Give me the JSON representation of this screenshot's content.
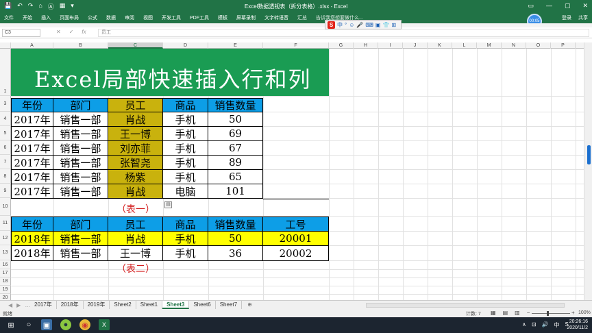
{
  "window": {
    "title": "Excel数据透视表（拆分表格）.xlsx - Excel"
  },
  "quick_access": [
    "💾",
    "↶",
    "↷",
    "⌂",
    "Ⓐ",
    "▦",
    "▾"
  ],
  "window_controls": [
    "▭",
    "—",
    "▢",
    "✕"
  ],
  "menu": [
    "文件",
    "开始",
    "插入",
    "页面布局",
    "公式",
    "数据",
    "审阅",
    "视图",
    "开发工具",
    "PDF工具",
    "模板",
    "屏幕录制",
    "文字转语音",
    "汇总"
  ],
  "tell_me": "告诉我您想要做什么...",
  "account": {
    "login": "登录",
    "share": "共享"
  },
  "recording": "00:05",
  "ime_bar": {
    "logo": "S",
    "items": [
      "中",
      "°",
      "☺",
      "🎤",
      "⌨",
      "▣",
      "👕",
      "⊞"
    ]
  },
  "formula_bar": {
    "name_box": "C3",
    "cancel": "✕",
    "enter": "✓",
    "fx": "fx",
    "formula": "员工"
  },
  "columns": [
    "A",
    "B",
    "C",
    "D",
    "E",
    "F",
    "G",
    "H",
    "I",
    "J",
    "K",
    "L",
    "M",
    "N",
    "O",
    "P"
  ],
  "rows": [
    "1",
    "3",
    "4",
    "5",
    "6",
    "7",
    "8",
    "9",
    "10",
    "11",
    "12",
    "13",
    "16",
    "17",
    "18",
    "19",
    "20"
  ],
  "banner": {
    "text": "Excel局部快速插入行和列"
  },
  "table1": {
    "headers": [
      "年份",
      "部门",
      "员工",
      "商品",
      "销售数量"
    ],
    "rows": [
      [
        "2017年",
        "销售一部",
        "肖战",
        "手机",
        "50"
      ],
      [
        "2017年",
        "销售一部",
        "王一博",
        "手机",
        "69"
      ],
      [
        "2017年",
        "销售一部",
        "刘亦菲",
        "手机",
        "67"
      ],
      [
        "2017年",
        "销售一部",
        "张智尧",
        "手机",
        "89"
      ],
      [
        "2017年",
        "销售一部",
        "杨紫",
        "手机",
        "65"
      ],
      [
        "2017年",
        "销售一部",
        "肖战",
        "电脑",
        "101"
      ]
    ],
    "caption": "（表一）"
  },
  "table2": {
    "headers": [
      "年份",
      "部门",
      "员工",
      "商品",
      "销售数量",
      "工号"
    ],
    "rows": [
      [
        "2018年",
        "销售一部",
        "肖战",
        "手机",
        "50",
        "20001"
      ],
      [
        "2018年",
        "销售一部",
        "王一博",
        "手机",
        "36",
        "20002"
      ]
    ],
    "caption": "（表二）"
  },
  "sheets": [
    "2017年",
    "2018年",
    "2019年",
    "Sheet2",
    "Sheet1",
    "Sheet3",
    "Sheet6",
    "Sheet7"
  ],
  "active_sheet": "Sheet3",
  "add_sheet": "⊕",
  "tab_nav": [
    "◀",
    "▶",
    "…"
  ],
  "status": {
    "ready": "就绪",
    "count": "计数: 7",
    "zoom": "100%",
    "views": [
      "▦",
      "▤",
      "▥"
    ],
    "zoom_minus": "−",
    "zoom_plus": "+"
  },
  "taskbar": {
    "start": "⊞",
    "search": "○",
    "time": "20:26:16",
    "date": "2020/11/2",
    "tray": [
      "∧",
      "⊡",
      "🔊",
      "中",
      "S"
    ]
  },
  "colors": {
    "excel_green": "#217346",
    "banner_green": "#1a9c53",
    "header_blue": "#0d9ee7",
    "olive": "#c9b20d",
    "yellow": "#ffff00",
    "caption_red": "#d32020"
  }
}
